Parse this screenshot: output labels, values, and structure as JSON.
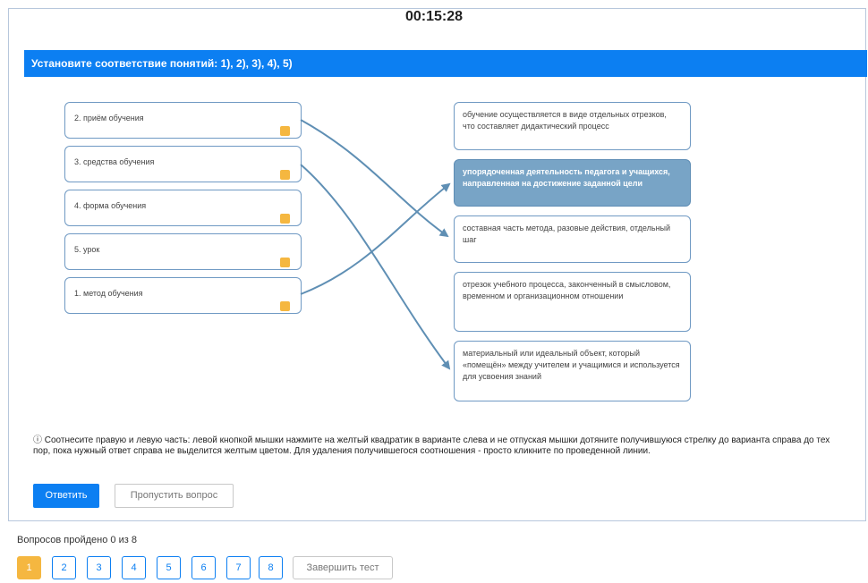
{
  "timer": "00:15:28",
  "question": {
    "title": "Установите соответствие понятий: 1), 2), 3), 4), 5)",
    "left_items": [
      {
        "label": "2. приём обучения"
      },
      {
        "label": "3. средства обучения"
      },
      {
        "label": "4. форма обучения"
      },
      {
        "label": "5. урок"
      },
      {
        "label": "1. метод обучения"
      }
    ],
    "right_items": [
      {
        "label": "обучение осуществляется в виде отдельных отрезков, что составляет дидактический процесс",
        "selected": false
      },
      {
        "label": "упорядоченная деятельность педагога и учащихся, направленная на достижение заданной цели",
        "selected": true
      },
      {
        "label": "составная часть метода, разовые действия, отдельный шаг",
        "selected": false
      },
      {
        "label": "отрезок учебного процесса, законченный в смысловом, временном и организационном отношении",
        "selected": false
      },
      {
        "label": "материальный или идеальный объект, который «помещён» между учителем и учащимися и используется для усвоения знаний",
        "selected": false
      }
    ],
    "hint": "ⓘ Соотнесите правую и левую часть: левой кнопкой мышки нажмите на желтый квадратик в варианте слева и не отпуская мышки дотяните получившуюся стрелку до варианта справа до тех пор, пока нужный ответ справа не выделится желтым цветом. Для удаления получившегося соотношения - просто кликните по проведенной линии."
  },
  "buttons": {
    "answer": "Ответить",
    "skip": "Пропустить вопрос"
  },
  "progress": {
    "text": "Вопросов пройдено 0 из 8",
    "pages": [
      "1",
      "2",
      "3",
      "4",
      "5",
      "6",
      "7",
      "8"
    ],
    "active_page": "1",
    "finish": "Завершить тест"
  },
  "colors": {
    "accent": "#0c7ff2",
    "handle": "#f5b740",
    "selected_answer": "#78a4c6",
    "arrow": "#5f8fb4"
  },
  "icons": {
    "handle": "yellow-square-handle",
    "info": "info-circle-icon",
    "arrow": "connection-arrow"
  }
}
